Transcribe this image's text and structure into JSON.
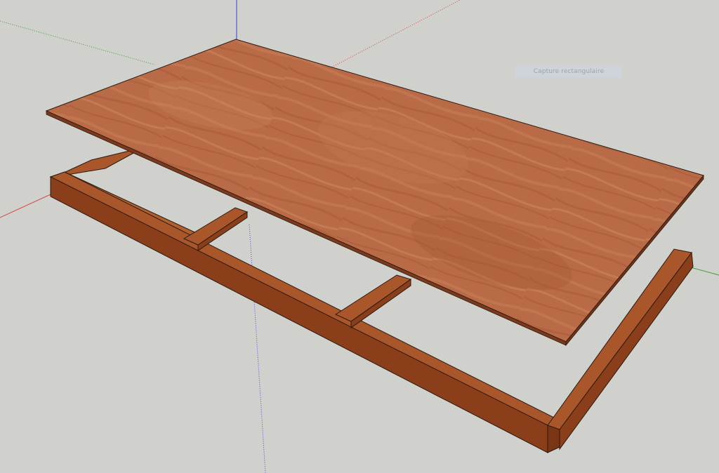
{
  "app": {
    "type": "3d-modeling-viewport"
  },
  "colors": {
    "background": "#d0d0cc",
    "axis_red": "#d94a4a",
    "axis_green": "#3aa03a",
    "axis_blue": "#3a3ad6",
    "plywood": "#b86a45",
    "frame_top": "#a9562a",
    "frame_side": "#8a3f1a",
    "edge": "#2a1a10"
  },
  "tooltip": {
    "text": "Capture rectangulaire"
  },
  "model": {
    "objects": [
      "plywood-panel",
      "wooden-frame"
    ]
  }
}
